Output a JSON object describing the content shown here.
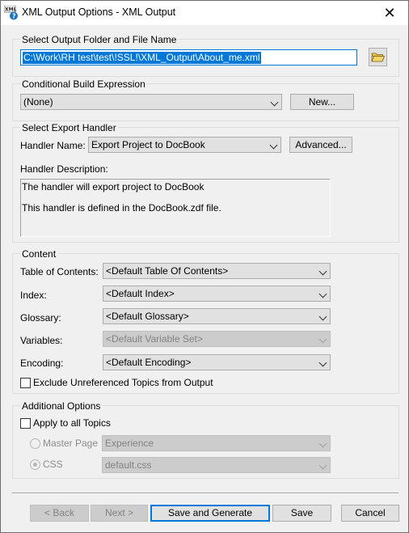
{
  "window": {
    "title": "XML Output Options - XML Output",
    "icon_text": "XML",
    "close_symbol": "✕"
  },
  "output_folder": {
    "legend": "Select Output Folder and File Name",
    "path_value": "C:\\Work\\RH test\\test\\!SSL!\\XML_Output\\About_me.xml"
  },
  "conditional_build": {
    "legend": "Conditional Build Expression",
    "selected": "(None)",
    "new_button": "New..."
  },
  "export_handler": {
    "legend": "Select Export Handler",
    "handler_label": "Handler Name:",
    "handler_value": "Export Project to DocBook",
    "advanced_button": "Advanced...",
    "description_label": "Handler Description:",
    "description_line1": "The handler will export project to DocBook",
    "description_line2": "This handler is defined in the DocBook.zdf file."
  },
  "content": {
    "legend": "Content",
    "toc_label": "Table of Contents:",
    "toc_value": "<Default Table Of Contents>",
    "index_label": "Index:",
    "index_value": "<Default Index>",
    "glossary_label": "Glossary:",
    "glossary_value": "<Default Glossary>",
    "variables_label": "Variables:",
    "variables_value": "<Default Variable Set>",
    "encoding_label": "Encoding:",
    "encoding_value": "<Default Encoding>",
    "exclude_label": "Exclude Unreferenced Topics from Output",
    "exclude_checked": false
  },
  "additional_options": {
    "legend": "Additional Options",
    "apply_all_label": "Apply to all Topics",
    "apply_all_checked": false,
    "master_page_label": "Master Page",
    "master_page_value": "Experience",
    "master_page_selected": false,
    "css_label": "CSS",
    "css_value": "default.css",
    "css_selected": true
  },
  "footer": {
    "back_button": "< Back",
    "next_button": "Next >",
    "save_generate_button": "Save and Generate",
    "save_button": "Save",
    "cancel_button": "Cancel"
  }
}
